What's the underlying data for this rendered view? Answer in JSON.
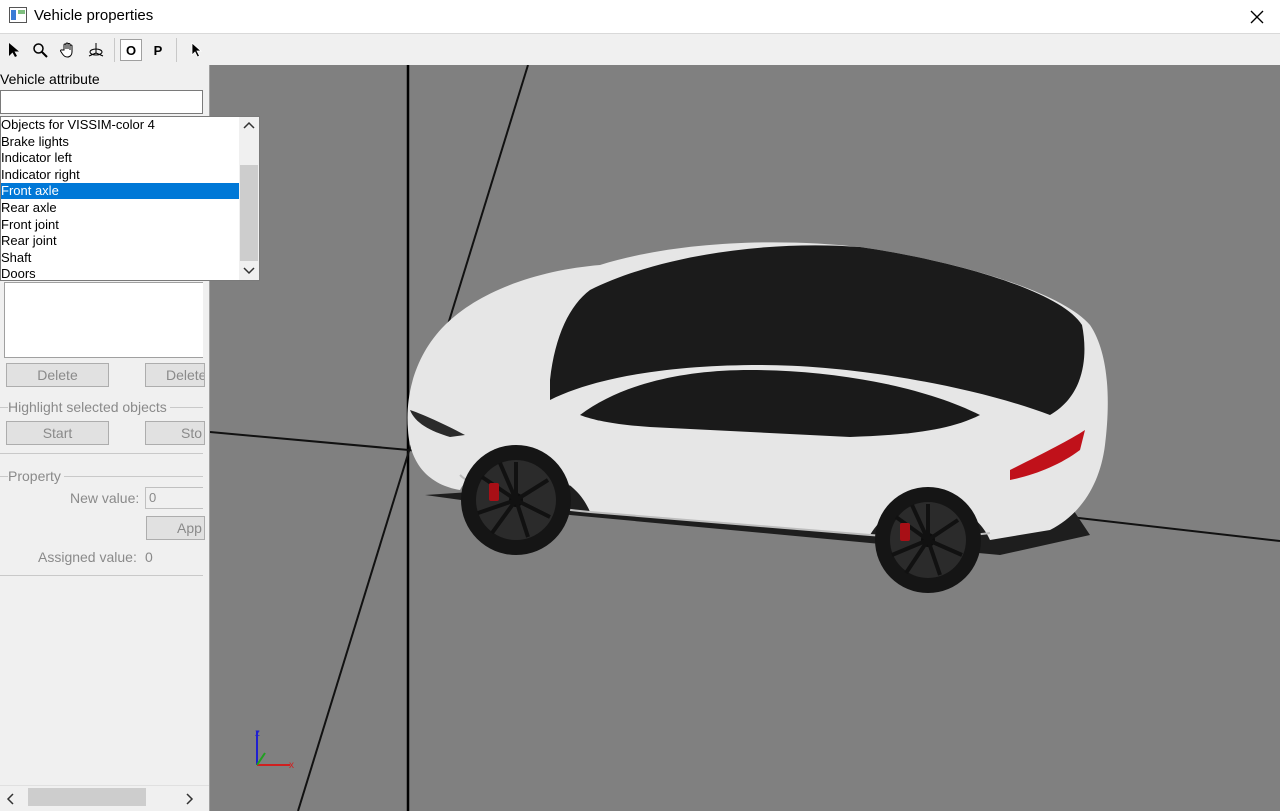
{
  "window": {
    "title": "Vehicle properties"
  },
  "toolbar": {
    "tools": [
      "select-icon",
      "zoom-icon",
      "pan-icon",
      "rotate-icon"
    ],
    "ortho_label": "O",
    "perspective_label": "P"
  },
  "panel": {
    "attribute_label": "Vehicle attribute",
    "attribute_value": "",
    "dropdown_items": [
      "Objects for VISSIM-color 4",
      "Brake lights",
      "Indicator left",
      "Indicator right",
      "Front axle",
      "Rear axle",
      "Front joint",
      "Rear joint",
      "Shaft",
      "Doors"
    ],
    "dropdown_selected": "Front axle",
    "delete_label": "Delete",
    "delete_all_label": "Delete",
    "highlight_group": "Highlight selected objects",
    "start_label": "Start",
    "stop_label": "Sto",
    "property_group": "Property",
    "new_value_label": "New value:",
    "new_value": "0",
    "apply_label": "App",
    "assigned_value_label": "Assigned value:",
    "assigned_value": "0"
  },
  "viewport": {
    "axis_labels": {
      "x": "x",
      "z": "z"
    },
    "colors": {
      "background": "#808080",
      "car_body": "#e8e8e8",
      "glass": "#1a1a1a",
      "tail_light": "#c0111a"
    }
  }
}
